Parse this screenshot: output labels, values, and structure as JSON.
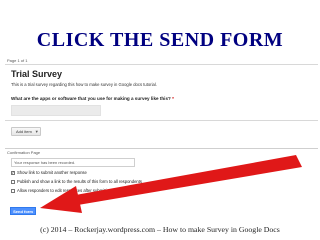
{
  "slide": {
    "title": "CLICK THE SEND FORM",
    "footer": "(c) 2014 – Rockerjay.wordpress.com – How to make Survey in Google Docs"
  },
  "form": {
    "page_label": "Page 1 of 1",
    "title": "Trial Survey",
    "description": "This is a trial survey regarding this how to make survey in Google docs tutorial.",
    "question": "What are the apps or software that you use for making a survey like this?",
    "required_mark": "*",
    "add_item_label": "Add item"
  },
  "confirmation": {
    "label": "Confirmation Page",
    "message_value": "Your response has been recorded.",
    "options": [
      {
        "label": "Show link to submit another response",
        "checked": true
      },
      {
        "label": "Publish and show a link to the results of this form to all respondents",
        "checked": false
      },
      {
        "label": "Allow responders to edit responses after submitting",
        "checked": false
      }
    ],
    "send_label": "Send form"
  },
  "colors": {
    "title": "#000080",
    "arrow": "#e01818",
    "send_button": "#4d90fe"
  }
}
